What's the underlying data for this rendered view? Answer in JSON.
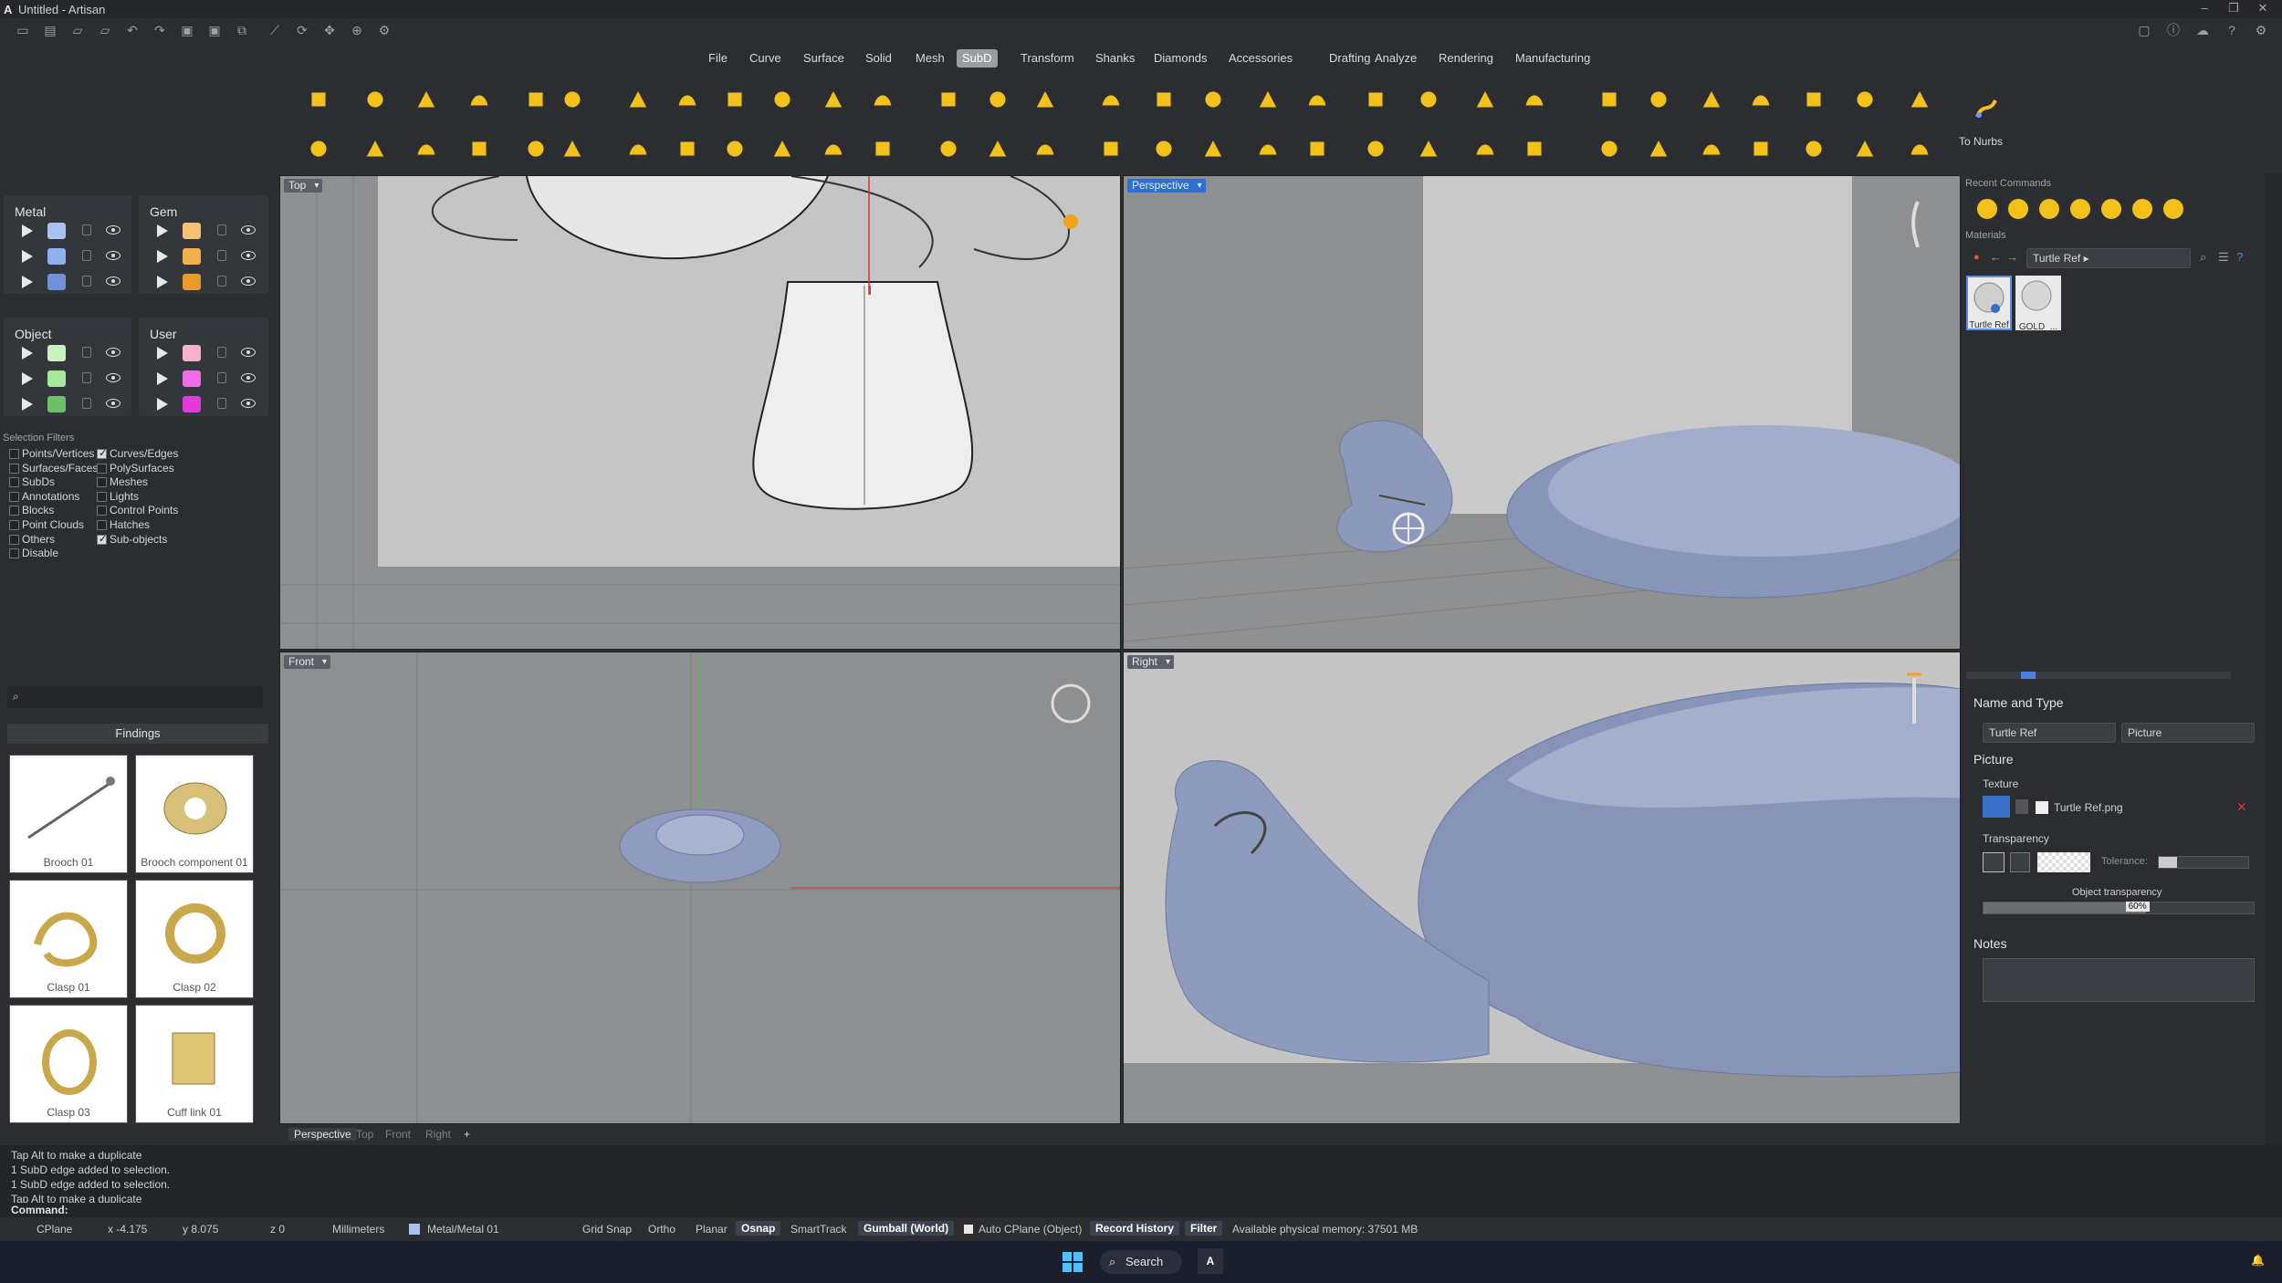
{
  "window": {
    "title": "Untitled - Artisan"
  },
  "menu": [
    {
      "label": "File"
    },
    {
      "label": "Curve"
    },
    {
      "label": "Surface"
    },
    {
      "label": "Solid"
    },
    {
      "label": "Mesh"
    },
    {
      "label": "SubD",
      "active": true
    },
    {
      "label": "Transform"
    },
    {
      "label": "Shanks"
    },
    {
      "label": "Diamonds"
    },
    {
      "label": "Accessories"
    },
    {
      "label": "Drafting"
    },
    {
      "label": "Analyze"
    },
    {
      "label": "Rendering"
    },
    {
      "label": "Manufacturing"
    }
  ],
  "ribbon": {
    "to_nurbs_label": "To Nurbs",
    "accent": "#f2c21b"
  },
  "layers": {
    "groups": [
      {
        "title": "Metal",
        "swatches": [
          "#a9c2f2",
          "#8fb0ee",
          "#6f91d8"
        ]
      },
      {
        "title": "Gem",
        "swatches": [
          "#f5c177",
          "#f1b04e",
          "#e99a2a"
        ]
      },
      {
        "title": "Object",
        "swatches": [
          "#c9f2c0",
          "#a6e89a",
          "#6cc06a"
        ]
      },
      {
        "title": "User",
        "swatches": [
          "#f5b2c9",
          "#f06ce8",
          "#e23bd8"
        ]
      }
    ]
  },
  "selection_filters": {
    "header": "Selection Filters",
    "left": [
      {
        "label": "Points/Vertices",
        "checked": false
      },
      {
        "label": "Surfaces/Faces",
        "checked": false
      },
      {
        "label": "SubDs",
        "checked": false
      },
      {
        "label": "Annotations",
        "checked": false
      },
      {
        "label": "Blocks",
        "checked": false
      },
      {
        "label": "Point Clouds",
        "checked": false
      },
      {
        "label": "Others",
        "checked": false
      },
      {
        "label": "Disable",
        "checked": false
      }
    ],
    "right": [
      {
        "label": "Curves/Edges",
        "checked": true
      },
      {
        "label": "PolySurfaces",
        "checked": false
      },
      {
        "label": "Meshes",
        "checked": false
      },
      {
        "label": "Lights",
        "checked": false
      },
      {
        "label": "Control Points",
        "checked": false
      },
      {
        "label": "Hatches",
        "checked": false
      },
      {
        "label": "Sub-objects",
        "checked": true
      }
    ]
  },
  "library": {
    "category": "Findings",
    "items": [
      "Brooch 01",
      "Brooch component 01",
      "Clasp 01",
      "Clasp 02",
      "Clasp 03",
      "Cuff link 01"
    ]
  },
  "viewports": {
    "top": "Top",
    "perspective": "Perspective",
    "front": "Front",
    "right": "Right"
  },
  "view_tabs": [
    "Perspective",
    "Top",
    "Front",
    "Right"
  ],
  "right_panel": {
    "recent_commands": "Recent Commands",
    "materials": "Materials",
    "breadcrumb": "Turtle Ref ▸",
    "material_thumbs": [
      "Turtle Ref",
      "GOLD_..."
    ],
    "name_and_type": "Name and Type",
    "name_value": "Turtle Ref",
    "type_value": "Picture",
    "picture": "Picture",
    "texture_label": "Texture",
    "texture_file": "Turtle Ref.png",
    "transparency_label": "Transparency",
    "tolerance_label": "Tolerance:",
    "object_transparency_label": "Object transparency",
    "object_transparency_value": "60%",
    "object_transparency_fraction": 0.6,
    "notes": "Notes"
  },
  "command_history": [
    "Tap Alt to make a duplicate",
    "1 SubD edge added to selection.",
    "1 SubD edge added to selection.",
    "Tap Alt to make a duplicate"
  ],
  "command_prompt": "Command:",
  "status": {
    "cplane": "CPlane",
    "x": "x -4.175",
    "y": "y 8.075",
    "z": "z 0",
    "units": "Millimeters",
    "layer": "Metal/Metal 01",
    "grid_snap": "Grid Snap",
    "ortho": "Ortho",
    "planar": "Planar",
    "osnap": "Osnap",
    "smarttrack": "SmartTrack",
    "gumball": "Gumball (World)",
    "auto_cplane": "Auto CPlane (Object)",
    "record_history": "Record History",
    "filter": "Filter",
    "memory": "Available physical memory: 37501 MB"
  },
  "taskbar": {
    "search": "Search"
  }
}
